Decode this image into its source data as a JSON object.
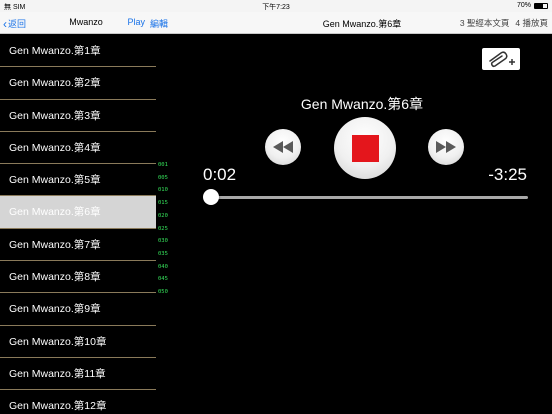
{
  "status_bar": {
    "carrier": "無 SIM",
    "time": "下午7:23",
    "battery": "70%"
  },
  "left_nav": {
    "back_label": "返回",
    "title": "Mwanzo",
    "play_label": "Play",
    "edit_label": "編輯"
  },
  "chapters": [
    {
      "label": "Gen Mwanzo.第1章"
    },
    {
      "label": "Gen Mwanzo.第2章"
    },
    {
      "label": "Gen Mwanzo.第3章"
    },
    {
      "label": "Gen Mwanzo.第4章"
    },
    {
      "label": "Gen Mwanzo.第5章"
    },
    {
      "label": "Gen Mwanzo.第6章"
    },
    {
      "label": "Gen Mwanzo.第7章"
    },
    {
      "label": "Gen Mwanzo.第8章"
    },
    {
      "label": "Gen Mwanzo.第9章"
    },
    {
      "label": "Gen Mwanzo.第10章"
    },
    {
      "label": "Gen Mwanzo.第11章"
    },
    {
      "label": "Gen Mwanzo.第12章"
    }
  ],
  "selected_chapter_index": 5,
  "index_labels": [
    "001",
    "005",
    "010",
    "015",
    "020",
    "025",
    "030",
    "035",
    "040",
    "045",
    "050"
  ],
  "right_nav": {
    "title": "Gen Mwanzo.第6章",
    "scripture_label": "3 聖經本文頁",
    "playlist_label": "4 播放頁"
  },
  "player": {
    "track_title": "Gen Mwanzo.第6章",
    "elapsed": "0:02",
    "remaining": "-3:25",
    "progress": 0.01
  },
  "colors": {
    "accent": "#1a73e8",
    "index_green": "#35e05a",
    "stop_red": "#e4161c",
    "divider": "#8a7a5a",
    "selected_row": "#d5d5d5"
  },
  "icons": {
    "back": "chevron-left-icon",
    "attach": "paperclip-plus-icon",
    "rewind": "rewind-icon",
    "stop": "stop-icon",
    "forward": "fast-forward-icon"
  }
}
